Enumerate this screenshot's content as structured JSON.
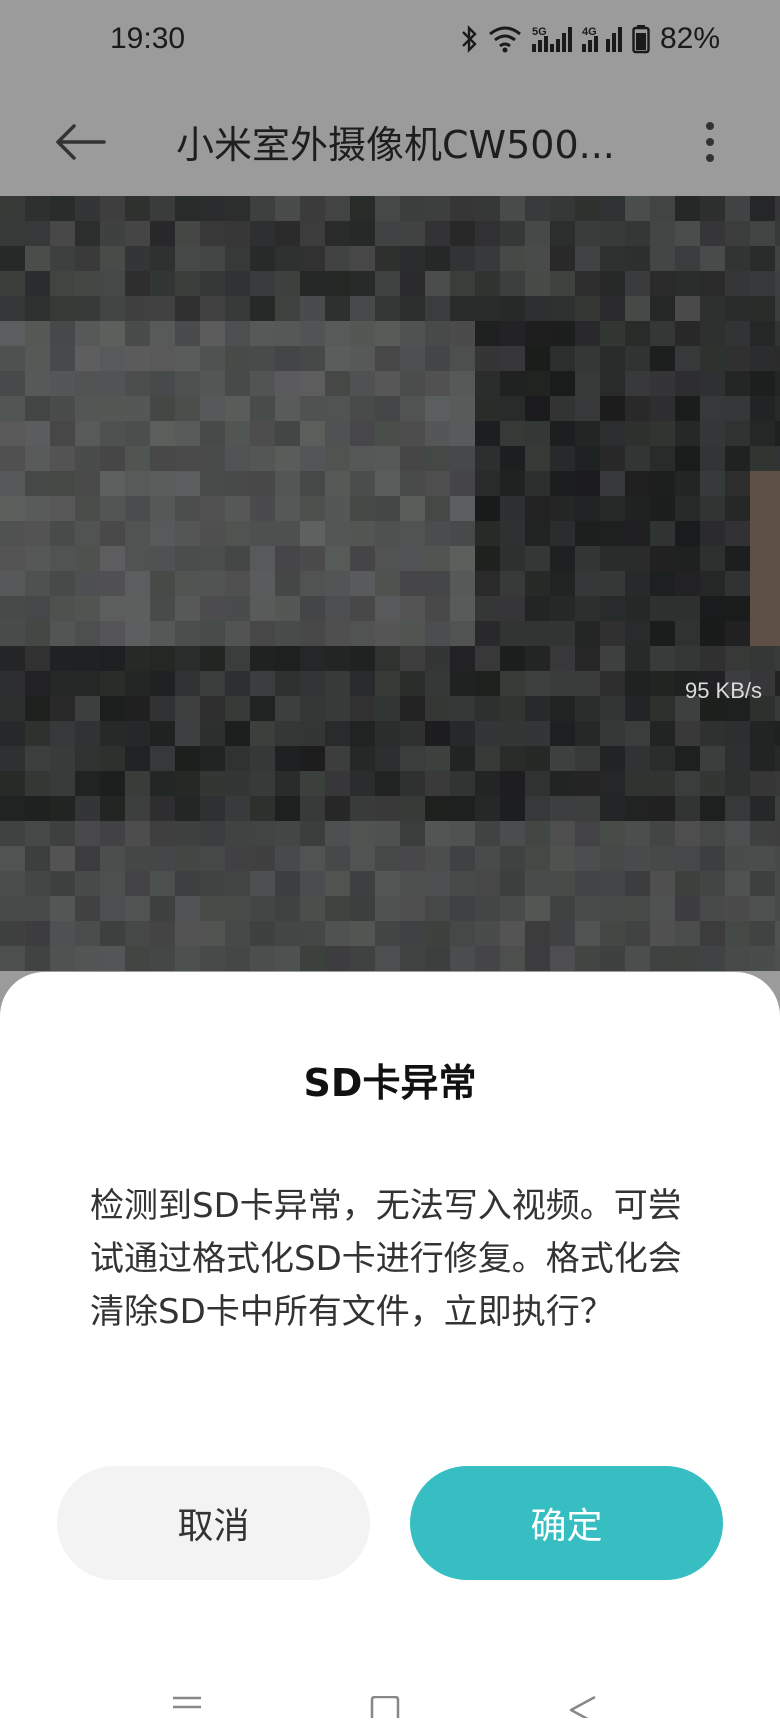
{
  "status_bar": {
    "time": "19:30",
    "battery": "82%",
    "net1": "5G",
    "net2": "4G",
    "icons": [
      "bluetooth-icon",
      "wifi-icon",
      "signal-5g-icon",
      "signal-4g-icon",
      "battery-icon"
    ]
  },
  "header": {
    "title": "小米室外摄像机CW500...",
    "back_icon": "arrow-left-icon",
    "more_icon": "more-vertical-icon"
  },
  "camera": {
    "bitrate": "95 KB/s"
  },
  "dialog": {
    "title": "SD卡异常",
    "message": "检测到SD卡异常，无法写入视频。可尝试通过格式化SD卡进行修复。格式化会清除SD卡中所有文件，立即执行？",
    "cancel_label": "取消",
    "confirm_label": "确定",
    "accent_color": "#36bec3"
  },
  "nav": {
    "icons": [
      "menu-icon",
      "home-icon",
      "back-icon"
    ]
  }
}
